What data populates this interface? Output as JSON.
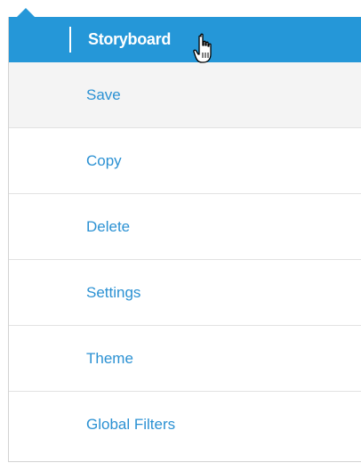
{
  "menu": {
    "header_title": "Storyboard",
    "items": [
      {
        "label": "Save"
      },
      {
        "label": "Copy"
      },
      {
        "label": "Delete"
      },
      {
        "label": "Settings"
      },
      {
        "label": "Theme"
      },
      {
        "label": "Global Filters"
      }
    ]
  },
  "colors": {
    "accent": "#2597d8",
    "link": "#2b91d3",
    "hover_bg": "#f4f4f4"
  },
  "icons": {
    "cursor": "hand-pointer-icon"
  }
}
